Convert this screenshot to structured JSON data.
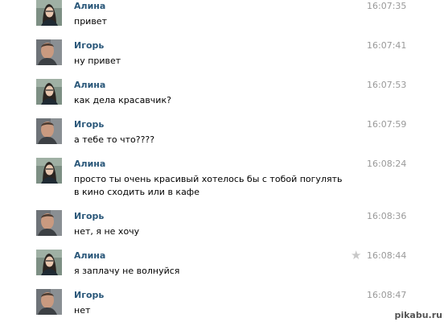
{
  "messages": [
    {
      "author": "Алина",
      "time": "16:07:35",
      "text": "привет"
    },
    {
      "author": "Игорь",
      "time": "16:07:41",
      "text": "ну привет"
    },
    {
      "author": "Алина",
      "time": "16:07:53",
      "text": "как дела красавчик?"
    },
    {
      "author": "Игорь",
      "time": "16:07:59",
      "text": "а тебе то что????"
    },
    {
      "author": "Алина",
      "time": "16:08:24",
      "text": "просто ты очень красивый хотелось бы с тобой погулять в кино сходить или в кафе"
    },
    {
      "author": "Игорь",
      "time": "16:08:36",
      "text": "нет, я не хочу"
    },
    {
      "author": "Алина",
      "time": "16:08:44",
      "text": "я заплачу не волнуйся"
    },
    {
      "author": "Игорь",
      "time": "16:08:47",
      "text": "нет"
    }
  ],
  "icons": {
    "favorite": "star-icon"
  },
  "watermark": "pikabu.ru",
  "colors": {
    "author": "#2b587a",
    "time": "#999999",
    "text": "#000000",
    "star": "#c8c8c8"
  }
}
